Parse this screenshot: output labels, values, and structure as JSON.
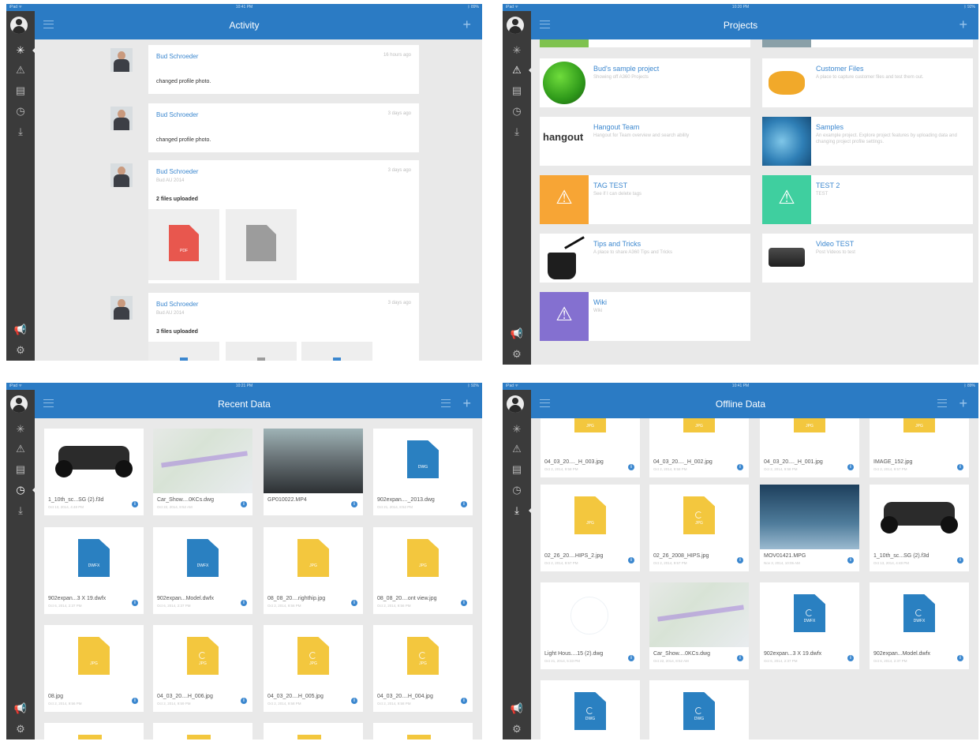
{
  "activity": {
    "status": {
      "left": "iPad ᯤ",
      "time": "10:41 PM",
      "right": "ᛒ 89%"
    },
    "title": "Activity",
    "items": [
      {
        "name": "Bud Schroeder",
        "time": "16 hours ago",
        "text": "changed profile photo."
      },
      {
        "name": "Bud Schroeder",
        "time": "3 days ago",
        "text": "changed profile photo."
      },
      {
        "name": "Bud Schroeder",
        "time": "3 days ago",
        "sub": "Bud AU 2014",
        "text": "2 files uploaded",
        "file_label": "PDF"
      },
      {
        "name": "Bud Schroeder",
        "time": "3 days ago",
        "sub": "Bud AU 2014",
        "text": "3 files uploaded"
      }
    ]
  },
  "projects": {
    "status": {
      "left": "iPad ᯤ",
      "time": "10:20 PM",
      "right": "ᛒ 92%"
    },
    "title": "Projects",
    "items": [
      {
        "name": "Bud's sample project",
        "desc": "Showing off A360 Projects"
      },
      {
        "name": "Customer Files",
        "desc": "A place to capture customer files and test them out."
      },
      {
        "name": "Hangout Team",
        "desc": "Hangout for Team overview and search ability",
        "thumb_text": "hangout"
      },
      {
        "name": "Samples",
        "desc": "An example project. Explore project features by uploading data and changing project profile settings."
      },
      {
        "name": "TAG TEST",
        "desc": "See if I can delete tags"
      },
      {
        "name": "TEST 2",
        "desc": "TEST"
      },
      {
        "name": "Tips and Tricks",
        "desc": "A place to share A360 Tips and Tricks"
      },
      {
        "name": "Video TEST",
        "desc": "Post Videos to test"
      },
      {
        "name": "Wiki",
        "desc": "Wiki"
      }
    ]
  },
  "recent": {
    "status": {
      "left": "iPad ᯤ",
      "time": "10:21 PM",
      "right": "ᛒ 92%"
    },
    "title": "Recent Data",
    "tiles": [
      {
        "name": "1_10th_sc...SG (2).f3d",
        "date": "Oct 13, 2014, 4:48 PM"
      },
      {
        "name": "Car_Show....0KCs.dwg",
        "date": "Oct 22, 2014, 8:52 AM"
      },
      {
        "name": "GP010022.MP4",
        "date": ""
      },
      {
        "name": "902expan...._2013.dwg",
        "date": "Oct 21, 2014, 8:52 PM",
        "label": "DWG"
      },
      {
        "name": "902expan...3 X 19.dwfx",
        "date": "Oct 6, 2014, 2:37 PM",
        "label": "DWFX"
      },
      {
        "name": "902expan...Model.dwfx",
        "date": "Oct 6, 2014, 2:37 PM",
        "label": "DWFX"
      },
      {
        "name": "08_08_20....righthip.jpg",
        "date": "Oct 2, 2014, 9:56 PM",
        "label": "JPG"
      },
      {
        "name": "08_08_20....ont view.jpg",
        "date": "Oct 2, 2014, 9:56 PM",
        "label": "JPG"
      },
      {
        "name": "08.jpg",
        "date": "Oct 2, 2014, 9:56 PM",
        "label": "JPG"
      },
      {
        "name": "04_03_20....H_006.jpg",
        "date": "Oct 2, 2014, 9:59 PM",
        "label": "JPG"
      },
      {
        "name": "04_03_20....H_005.jpg",
        "date": "Oct 2, 2014, 9:58 PM",
        "label": "JPG"
      },
      {
        "name": "04_03_20....H_004.jpg",
        "date": "Oct 2, 2014, 9:58 PM",
        "label": "JPG"
      }
    ]
  },
  "offline": {
    "status": {
      "left": "iPad ᯤ",
      "time": "10:41 PM",
      "right": "ᛒ 89%"
    },
    "title": "Offline Data",
    "tiles": [
      {
        "name": "04_03_20...._H_003.jpg",
        "date": "Oct 2, 2014, 9:58 PM",
        "label": "JPG"
      },
      {
        "name": "04_03_20...._H_002.jpg",
        "date": "Oct 2, 2014, 9:58 PM",
        "label": "JPG"
      },
      {
        "name": "04_03_20...._H_001.jpg",
        "date": "Oct 2, 2014, 9:58 PM",
        "label": "JPG"
      },
      {
        "name": "IMAGE_152.jpg",
        "date": "Oct 2, 2014, 9:57 PM",
        "label": "JPG"
      },
      {
        "name": "02_26_20....HIPS_2.jpg",
        "date": "Oct 2, 2014, 9:57 PM",
        "label": "JPG"
      },
      {
        "name": "02_26_2008_HIPS.jpg",
        "date": "Oct 2, 2014, 9:57 PM",
        "label": "JPG"
      },
      {
        "name": "MOV01421.MPG",
        "date": "Nov 3, 2014, 10:05 AM"
      },
      {
        "name": "1_10th_sc...SG (2).f3d",
        "date": "Oct 13, 2014, 4:48 PM"
      },
      {
        "name": "Light Hous....15 (2).dwg",
        "date": "Oct 21, 2014, 5:33 PM"
      },
      {
        "name": "Car_Show....0KCs.dwg",
        "date": "Oct 22, 2014, 8:52 AM"
      },
      {
        "name": "902expan...3 X 19.dwfx",
        "date": "Oct 6, 2014, 2:37 PM",
        "label": "DWFX"
      },
      {
        "name": "902expan...Model.dwfx",
        "date": "Oct 6, 2014, 2:37 PM",
        "label": "DWFX"
      },
      {
        "name": "",
        "date": "",
        "label": "DWG"
      },
      {
        "name": "",
        "date": "",
        "label": "DWG"
      }
    ]
  },
  "sidebar": {
    "icons": [
      "activity-icon",
      "projects-icon",
      "data-icon",
      "recent-icon",
      "offline-icon",
      "announcements-icon",
      "settings-icon"
    ]
  },
  "colors": {
    "nav_blue": "#2b7bc4",
    "sidebar": "#3b3b3b",
    "link_blue": "#3b87cf",
    "jpg": "#f3c73e",
    "dwg": "#2a80c1",
    "pdf": "#e8574e",
    "tag_orange": "#f7a535",
    "test_green": "#3fcf9f",
    "wiki_purple": "#8470d0"
  }
}
